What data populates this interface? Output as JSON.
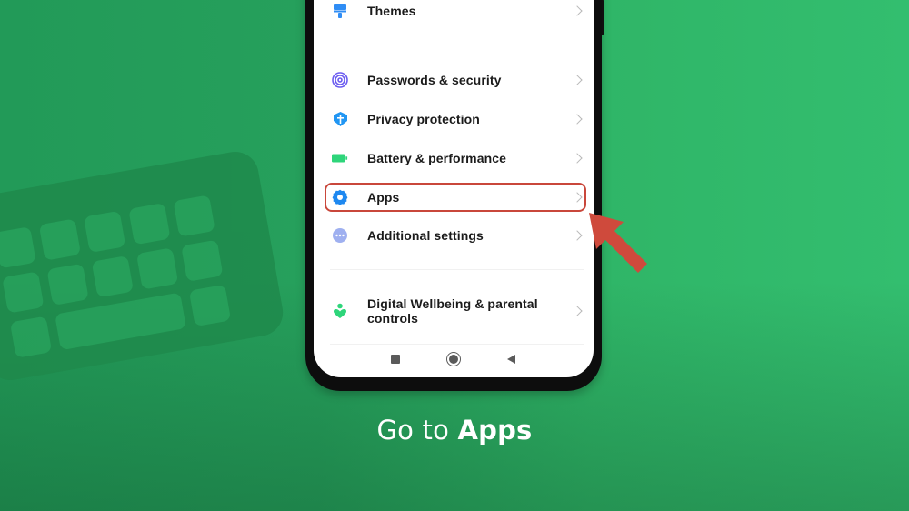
{
  "settings_list": {
    "items": [
      {
        "label": "Themes",
        "icon": "paintbrush-icon",
        "icon_color": "#2f8df5"
      },
      {
        "label": "Passwords & security",
        "icon": "fingerprint-target-icon",
        "icon_color": "#6b5cf0"
      },
      {
        "label": "Privacy protection",
        "icon": "shield-icon",
        "icon_color": "#2196f3"
      },
      {
        "label": "Battery & performance",
        "icon": "battery-icon",
        "icon_color": "#2ed57a"
      },
      {
        "label": "Apps",
        "icon": "gear-icon",
        "icon_color": "#1e88f0",
        "highlighted": true
      },
      {
        "label": "Additional settings",
        "icon": "more-dots-icon",
        "icon_color": "#9fb0f0"
      },
      {
        "label": "Digital Wellbeing & parental controls",
        "icon": "wellbeing-heart-icon",
        "icon_color": "#2ed57a"
      }
    ]
  },
  "navbar": {
    "buttons": [
      "recents-square-icon",
      "home-circle-icon",
      "back-triangle-icon"
    ]
  },
  "caption": {
    "prefix": "Go to ",
    "emphasis": "Apps"
  },
  "colors": {
    "highlight": "#c9473b",
    "arrow": "#cf4a3c",
    "background": "#2fb567"
  }
}
